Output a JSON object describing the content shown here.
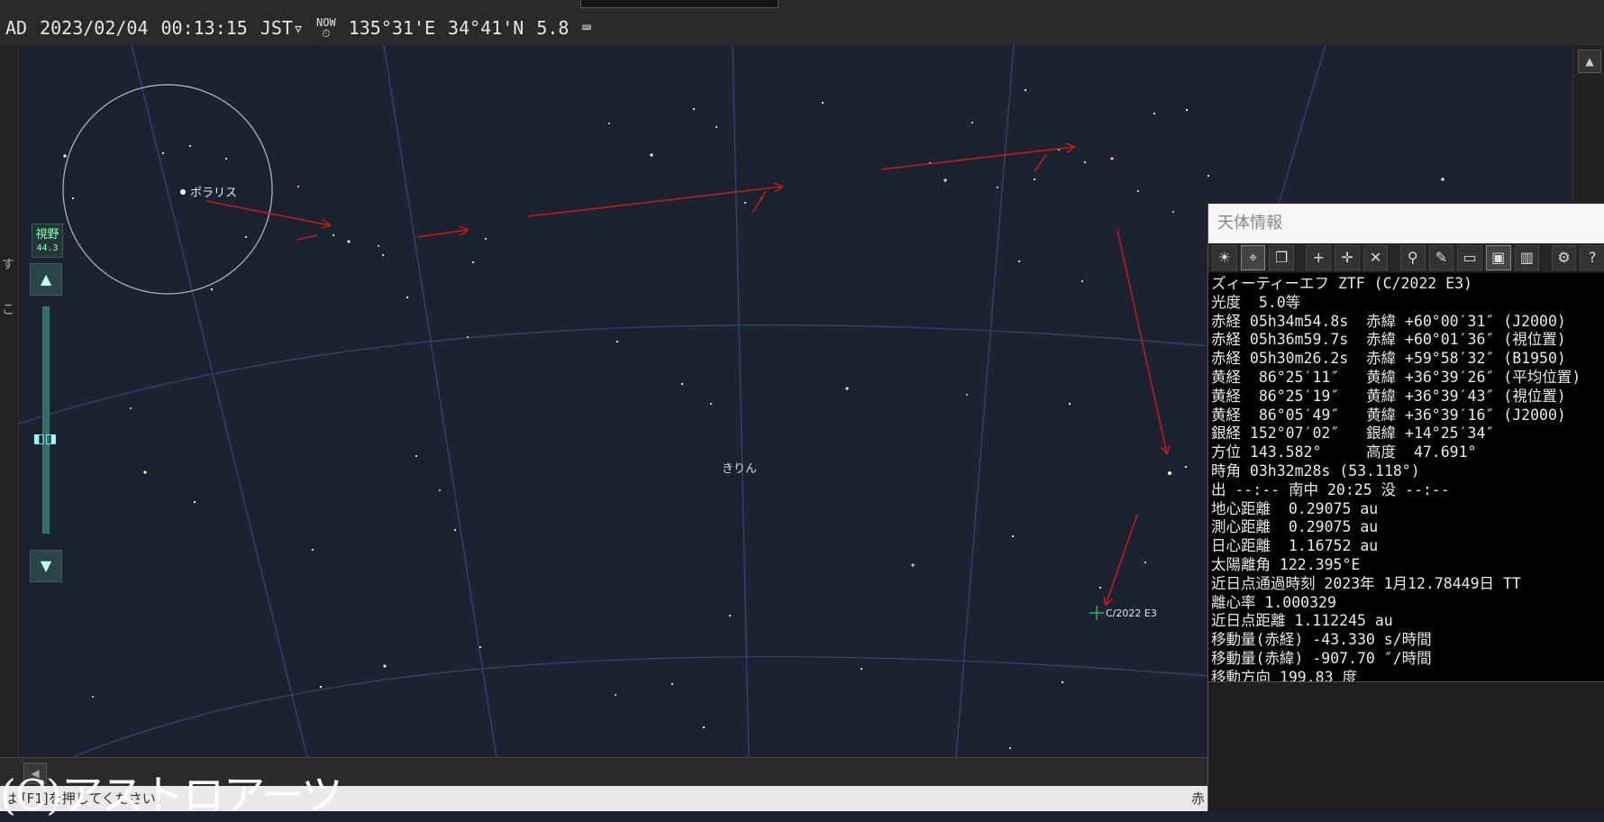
{
  "status": {
    "era": "AD",
    "date": "2023/02/04",
    "time": "00:13:15",
    "timezone": "JST▿",
    "now_label": "NOW",
    "longitude": "135°31'E",
    "latitude": "34°41'N",
    "magnitude": "5.8"
  },
  "fov": {
    "label": "視野",
    "value": "44.3"
  },
  "sky": {
    "polaris_label": "ポラリス",
    "constellation_label": "きりん",
    "comet_label": "C/2022 E3"
  },
  "left_strip": {
    "char1": "す",
    "char2": "こ"
  },
  "statusbar": {
    "message": "は [F1]を押してください。",
    "right": "赤"
  },
  "copyright": "(C)アストロアーツ",
  "panel": {
    "title": "天体情報",
    "toolbar_icons": [
      "sun-icon",
      "target-icon",
      "layers-icon",
      "crosshair-icon",
      "crosshair-lock-icon",
      "crosshair-off-icon",
      "telescope-icon",
      "pencil-icon",
      "window-icon",
      "image-icon",
      "book-icon",
      "gear-icon",
      "help-icon"
    ],
    "lines": [
      "ズィーティーエフ ZTF (C/2022 E3)",
      "光度  5.0等",
      "赤経 05h34m54.8s  赤緯 +60°00′31″ (J2000)",
      "赤経 05h36m59.7s  赤緯 +60°01′36″ (視位置)",
      "赤経 05h30m26.2s  赤緯 +59°58′32″ (B1950)",
      "黄経  86°25′11″   黄緯 +36°39′26″ (平均位置)",
      "黄経  86°25′19″   黄緯 +36°39′43″ (視位置)",
      "黄経  86°05′49″   黄緯 +36°39′16″ (J2000)",
      "銀経 152°07′02″   銀緯 +14°25′34″",
      "方位 143.582°     高度  47.691°",
      "時角 03h32m28s (53.118°)",
      "出 --:-- 南中 20:25 没 --:--",
      "地心距離  0.29075 au",
      "測心距離  0.29075 au",
      "日心距離  1.16752 au",
      "太陽離角 122.395°E",
      "近日点通過時刻 2023年 1月12.78449日 TT",
      "離心率 1.000329",
      "近日点距離 1.112245 au",
      "移動量(赤経) -43.330 s/時間",
      "移動量(赤緯) -907.70 ″/時間",
      "移動方向 199.83 度"
    ]
  },
  "colors": {
    "sky": "#1b2230",
    "grid": "#33457a",
    "arrow": "#c21a1a",
    "fov_circle": "#b9b9b9"
  }
}
